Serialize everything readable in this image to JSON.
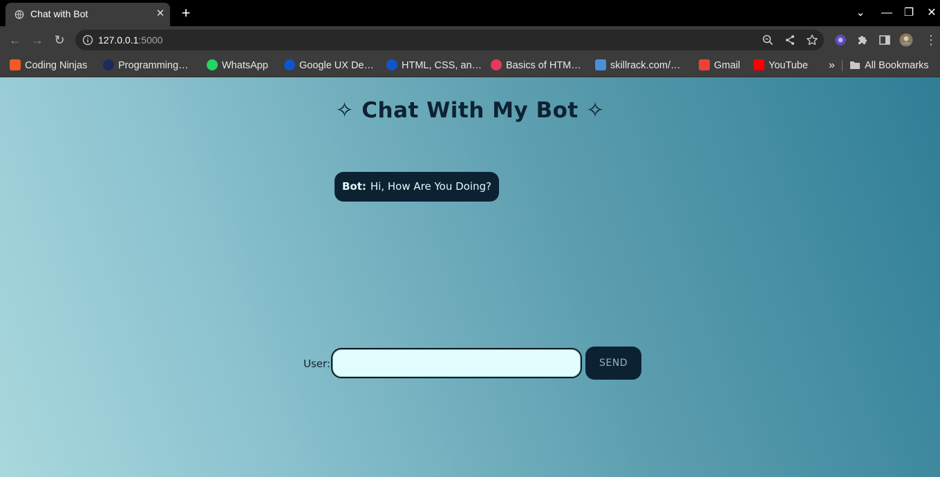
{
  "browser": {
    "tab": {
      "title": "Chat with Bot",
      "close": "✕"
    },
    "new_tab": "+",
    "window": {
      "minimize": "—",
      "maximize": "❐",
      "close": "✕",
      "tab_search": "⌄"
    },
    "nav": {
      "back": "←",
      "forward": "→",
      "reload": "↻"
    },
    "address": {
      "host": "127.0.0.1",
      "port": ":5000"
    },
    "bookmarks": [
      {
        "label": "Coding Ninjas",
        "icon": "coding-ninjas-icon",
        "color": "#f15a24"
      },
      {
        "label": "Programming…",
        "icon": "programming-icon",
        "color": "#1d2a5e"
      },
      {
        "label": "WhatsApp",
        "icon": "whatsapp-icon",
        "color": "#25d366"
      },
      {
        "label": "Google UX De…",
        "icon": "coursera-icon",
        "color": "#1155cc"
      },
      {
        "label": "HTML, CSS, an…",
        "icon": "coursera-icon",
        "color": "#1155cc"
      },
      {
        "label": "Basics of HTM…",
        "icon": "basics-icon",
        "color": "#e5395b"
      },
      {
        "label": "skillrack.com/…",
        "icon": "skillrack-icon",
        "color": "#4a90d9"
      },
      {
        "label": "Gmail",
        "icon": "gmail-icon",
        "color": "#ea4335"
      },
      {
        "label": "YouTube",
        "icon": "youtube-icon",
        "color": "#ff0000"
      }
    ],
    "more_bookmarks": "»",
    "all_bookmarks": "All Bookmarks"
  },
  "page": {
    "heading": "✧ Chat With My Bot ✧",
    "messages": [
      {
        "sender": "Bot:",
        "text": "Hi, How Are You Doing?"
      }
    ],
    "input": {
      "label": "User:",
      "value": "",
      "placeholder": ""
    },
    "send_label": "SEND"
  },
  "colors": {
    "bubble": "#0c2233",
    "input_bg": "#e1fdfd",
    "gradient_light": "#a9d8dd",
    "gradient_dark": "#2f7e96"
  }
}
